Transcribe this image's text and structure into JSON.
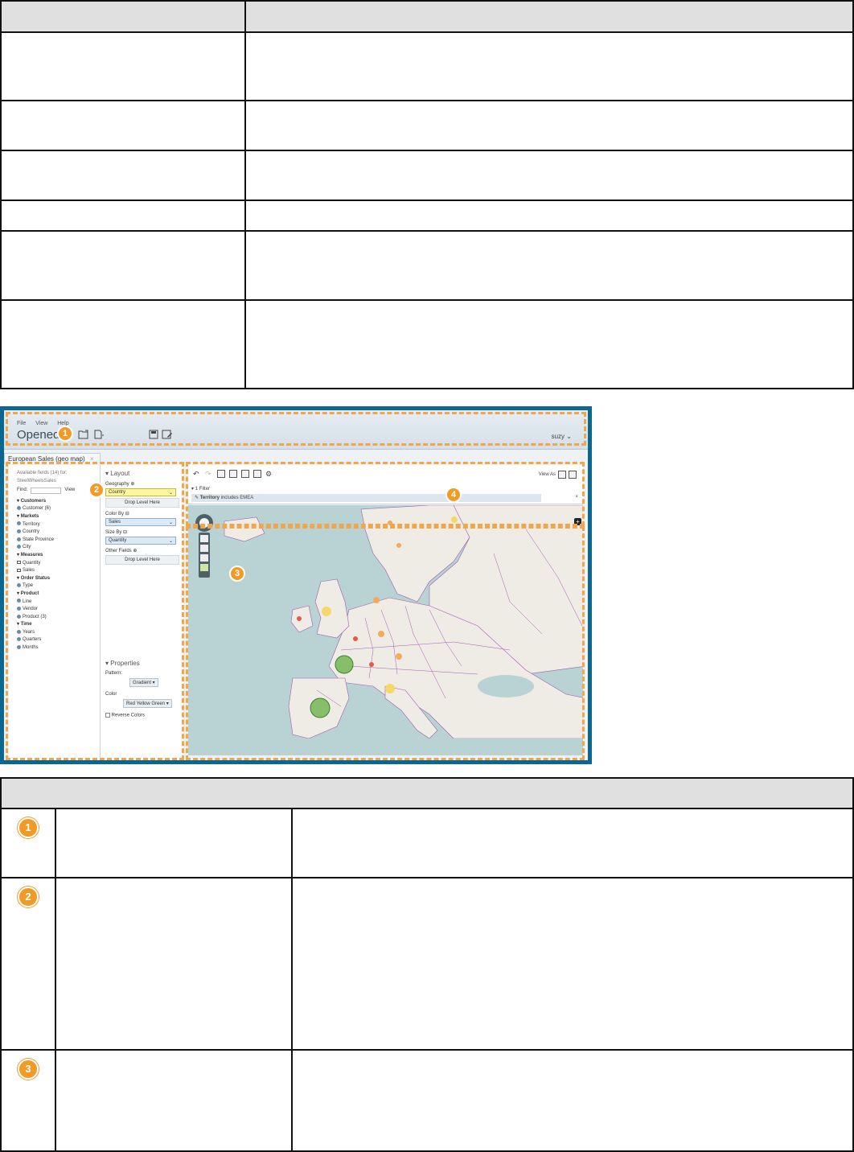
{
  "app": {
    "menu": [
      "File",
      "View",
      "Help"
    ],
    "title": "Opened",
    "user": "suzy",
    "tab_label": "European Sales (geo map)",
    "tab_close": "×"
  },
  "fields": {
    "available": "Available fields (14) for:",
    "source": "SteelWheelsSales",
    "find_label": "Find:",
    "view_label": "View",
    "items": [
      {
        "label": "Customers",
        "kind": "group"
      },
      {
        "label": "Customer (6)",
        "kind": "level"
      },
      {
        "label": "Markets",
        "kind": "group"
      },
      {
        "label": "Territory",
        "kind": "level"
      },
      {
        "label": "Country",
        "kind": "level"
      },
      {
        "label": "State Province",
        "kind": "level"
      },
      {
        "label": "City",
        "kind": "level"
      },
      {
        "label": "Measures",
        "kind": "group"
      },
      {
        "label": "Quantity",
        "kind": "measure"
      },
      {
        "label": "Sales",
        "kind": "measure"
      },
      {
        "label": "Order Status",
        "kind": "group"
      },
      {
        "label": "Type",
        "kind": "level"
      },
      {
        "label": "Product",
        "kind": "group"
      },
      {
        "label": "Line",
        "kind": "level"
      },
      {
        "label": "Vendor",
        "kind": "level"
      },
      {
        "label": "Product (3)",
        "kind": "level"
      },
      {
        "label": "Time",
        "kind": "group"
      },
      {
        "label": "Years",
        "kind": "level"
      },
      {
        "label": "Quarters",
        "kind": "level"
      },
      {
        "label": "Months",
        "kind": "level"
      }
    ]
  },
  "layout": {
    "heading": "Layout",
    "geography_label": "Geography",
    "geography_value": "Country",
    "drop_here": "Drop Level Here",
    "color_by_label": "Color By",
    "color_by_value": "Sales",
    "size_by_label": "Size By",
    "size_by_value": "Quantity",
    "other_fields_label": "Other Fields",
    "drop_here_2": "Drop Level Here"
  },
  "properties": {
    "heading": "Properties",
    "pattern_label": "Pattern:",
    "pattern_value": "Gradient",
    "color_label": "Color",
    "color_value": "Red Yellow Green",
    "reverse_label": "Reverse Colors"
  },
  "toolbar": {
    "view_as": "View As",
    "filter_count": "1 Filter",
    "filter_field": "Territory",
    "filter_rest": "includes EMEA",
    "filter_close": "×"
  },
  "badges": [
    "1",
    "2",
    "3",
    "4"
  ],
  "colors": {
    "frame": "#0a6791",
    "region_border": "#f0a64a",
    "badge": "#f29a26",
    "sea": "#b9d3d4",
    "land": "#efece6",
    "border_lines": "#a05bb0"
  },
  "map_bubbles": [
    {
      "color": "#6bb34a",
      "size": "large"
    },
    {
      "color": "#6bb34a",
      "size": "large"
    },
    {
      "color": "#f5d75a",
      "size": "medium"
    },
    {
      "color": "#f5d75a",
      "size": "small"
    },
    {
      "color": "#f5a95a",
      "size": "small"
    },
    {
      "color": "#e8584a",
      "size": "small"
    }
  ]
}
